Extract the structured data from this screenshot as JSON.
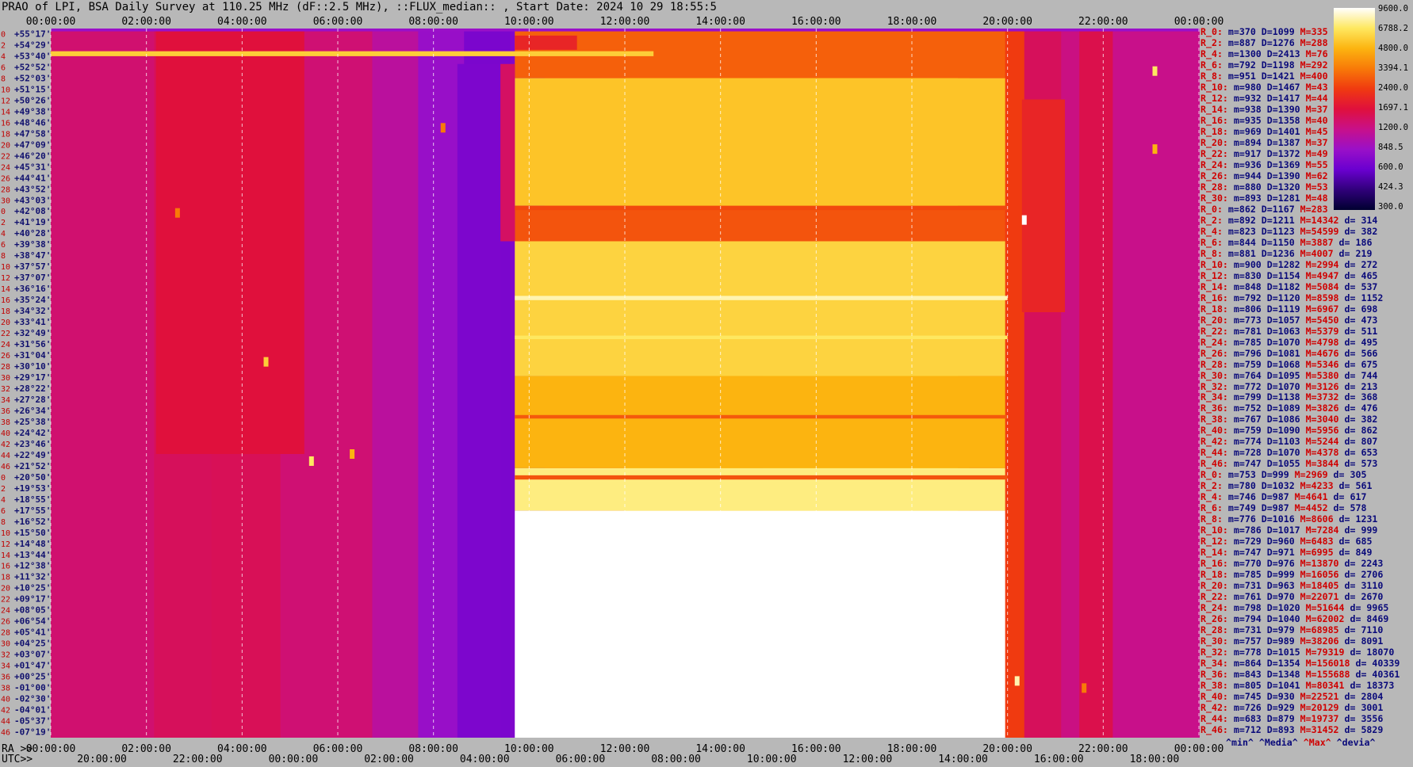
{
  "title": "PRAO of LPI, BSA Daily Survey at 110.25 MHz (dF::2.5 MHz), ::FLUX_median:: , Start Date: 2024 10 29 18:55:5",
  "chart_data": {
    "type": "heatmap",
    "title": "PRAO of LPI, BSA Daily Survey at 110.25 MHz (dF::2.5 MHz), ::FLUX_median:: , Start Date: 2024 10 29 18:55:5",
    "x_top_ticks": [
      "00:00:00",
      "02:00:00",
      "04:00:00",
      "06:00:00",
      "08:00:00",
      "10:00:00",
      "12:00:00",
      "14:00:00",
      "16:00:00",
      "18:00:00",
      "20:00:00",
      "22:00:00",
      "00:00:00"
    ],
    "x_bottom_ra_label": "RA >>",
    "x_bottom_ra_ticks": [
      "00:00:00",
      "02:00:00",
      "04:00:00",
      "06:00:00",
      "08:00:00",
      "10:00:00",
      "12:00:00",
      "14:00:00",
      "16:00:00",
      "18:00:00",
      "20:00:00",
      "22:00:00",
      "00:00:00"
    ],
    "x_bottom_utc_label": "UTC>>",
    "x_bottom_utc_ticks": [
      "20:00:00",
      "22:00:00",
      "00:00:00",
      "02:00:00",
      "04:00:00",
      "06:00:00",
      "08:00:00",
      "10:00:00",
      "12:00:00",
      "14:00:00",
      "16:00:00",
      "18:00:00"
    ],
    "y_rows": [
      {
        "row": "0",
        "dec": "+55°17'"
      },
      {
        "row": "2",
        "dec": "+54°29'"
      },
      {
        "row": "4",
        "dec": "+53°40'"
      },
      {
        "row": "6",
        "dec": "+52°52'"
      },
      {
        "row": "8",
        "dec": "+52°03'"
      },
      {
        "row": "10",
        "dec": "+51°15'"
      },
      {
        "row": "12",
        "dec": "+50°26'"
      },
      {
        "row": "14",
        "dec": "+49°38'"
      },
      {
        "row": "16",
        "dec": "+48°46'"
      },
      {
        "row": "18",
        "dec": "+47°58'"
      },
      {
        "row": "20",
        "dec": "+47°09'"
      },
      {
        "row": "22",
        "dec": "+46°20'"
      },
      {
        "row": "24",
        "dec": "+45°31'"
      },
      {
        "row": "26",
        "dec": "+44°41'"
      },
      {
        "row": "28",
        "dec": "+43°52'"
      },
      {
        "row": "30",
        "dec": "+43°03'"
      },
      {
        "row": "0",
        "dec": "+42°08'"
      },
      {
        "row": "2",
        "dec": "+41°19'"
      },
      {
        "row": "4",
        "dec": "+40°28'"
      },
      {
        "row": "6",
        "dec": "+39°38'"
      },
      {
        "row": "8",
        "dec": "+38°47'"
      },
      {
        "row": "10",
        "dec": "+37°57'"
      },
      {
        "row": "12",
        "dec": "+37°07'"
      },
      {
        "row": "14",
        "dec": "+36°16'"
      },
      {
        "row": "16",
        "dec": "+35°24'"
      },
      {
        "row": "18",
        "dec": "+34°32'"
      },
      {
        "row": "20",
        "dec": "+33°41'"
      },
      {
        "row": "22",
        "dec": "+32°49'"
      },
      {
        "row": "24",
        "dec": "+31°56'"
      },
      {
        "row": "26",
        "dec": "+31°04'"
      },
      {
        "row": "28",
        "dec": "+30°10'"
      },
      {
        "row": "30",
        "dec": "+29°17'"
      },
      {
        "row": "32",
        "dec": "+28°22'"
      },
      {
        "row": "34",
        "dec": "+27°28'"
      },
      {
        "row": "36",
        "dec": "+26°34'"
      },
      {
        "row": "38",
        "dec": "+25°38'"
      },
      {
        "row": "40",
        "dec": "+24°42'"
      },
      {
        "row": "42",
        "dec": "+23°46'"
      },
      {
        "row": "44",
        "dec": "+22°49'"
      },
      {
        "row": "46",
        "dec": "+21°52'"
      },
      {
        "row": "0",
        "dec": "+20°50'"
      },
      {
        "row": "2",
        "dec": "+19°53'"
      },
      {
        "row": "4",
        "dec": "+18°55'"
      },
      {
        "row": "6",
        "dec": "+17°55'"
      },
      {
        "row": "8",
        "dec": "+16°52'"
      },
      {
        "row": "10",
        "dec": "+15°50'"
      },
      {
        "row": "12",
        "dec": "+14°48'"
      },
      {
        "row": "14",
        "dec": "+13°44'"
      },
      {
        "row": "16",
        "dec": "+12°38'"
      },
      {
        "row": "18",
        "dec": "+11°32'"
      },
      {
        "row": "20",
        "dec": "+10°25'"
      },
      {
        "row": "22",
        "dec": "+09°17'"
      },
      {
        "row": "24",
        "dec": "+08°05'"
      },
      {
        "row": "26",
        "dec": "+06°54'"
      },
      {
        "row": "28",
        "dec": "+05°41'"
      },
      {
        "row": "30",
        "dec": "+04°25'"
      },
      {
        "row": "32",
        "dec": "+03°07'"
      },
      {
        "row": "34",
        "dec": "+01°47'"
      },
      {
        "row": "36",
        "dec": "+00°25'"
      },
      {
        "row": "38",
        "dec": "-01°00'"
      },
      {
        "row": "40",
        "dec": "-02°30'"
      },
      {
        "row": "42",
        "dec": "-04°01'"
      },
      {
        "row": "44",
        "dec": "-05°37'"
      },
      {
        "row": "46",
        "dec": "-07°19'"
      }
    ],
    "colorbar_ticks": [
      "9600.0",
      "6788.2",
      "4800.0",
      "3394.1",
      "2400.0",
      "1697.1",
      "1200.0",
      "848.5",
      "600.0",
      "424.3",
      "300.0"
    ],
    "colorbar_range": [
      300,
      9600
    ],
    "colorbar_scale": "log",
    "colormap_stops": [
      "#000030",
      "#30007a",
      "#6a00d0",
      "#9a10c8",
      "#c8108a",
      "#e0103c",
      "#f03a10",
      "#f87a08",
      "#fcb410",
      "#fee860",
      "#ffffff"
    ],
    "stats": [
      {
        "ch": "R_0:",
        "m": "370",
        "d": "1099",
        "max": "335",
        "dev": ""
      },
      {
        "ch": "R_2:",
        "m": "887",
        "d": "1276",
        "max": "288",
        "dev": ""
      },
      {
        "ch": "R_4:",
        "m": "1300",
        "d": "2413",
        "max": "76",
        "dev": ""
      },
      {
        "ch": "R_6:",
        "m": "792",
        "d": "1198",
        "max": "292",
        "dev": ""
      },
      {
        "ch": "R_8:",
        "m": "951",
        "d": "1421",
        "max": "400",
        "dev": ""
      },
      {
        "ch": "R_10:",
        "m": "980",
        "d": "1467",
        "max": "43",
        "dev": ""
      },
      {
        "ch": "R_12:",
        "m": "932",
        "d": "1417",
        "max": "44",
        "dev": ""
      },
      {
        "ch": "R_14:",
        "m": "938",
        "d": "1390",
        "max": "37",
        "dev": ""
      },
      {
        "ch": "R_16:",
        "m": "935",
        "d": "1358",
        "max": "40",
        "dev": ""
      },
      {
        "ch": "R_18:",
        "m": "969",
        "d": "1401",
        "max": "45",
        "dev": ""
      },
      {
        "ch": "R_20:",
        "m": "894",
        "d": "1387",
        "max": "37",
        "dev": ""
      },
      {
        "ch": "R_22:",
        "m": "917",
        "d": "1372",
        "max": "49",
        "dev": ""
      },
      {
        "ch": "R_24:",
        "m": "936",
        "d": "1369",
        "max": "55",
        "dev": ""
      },
      {
        "ch": "R_26:",
        "m": "944",
        "d": "1390",
        "max": "62",
        "dev": ""
      },
      {
        "ch": "R_28:",
        "m": "880",
        "d": "1320",
        "max": "53",
        "dev": ""
      },
      {
        "ch": "R_30:",
        "m": "893",
        "d": "1281",
        "max": "48",
        "dev": ""
      },
      {
        "ch": "R_0:",
        "m": "862",
        "d": "1167",
        "max": "283",
        "dev": ""
      },
      {
        "ch": "R_2:",
        "m": "892",
        "d": "1211",
        "max": "14342",
        "dev": "314"
      },
      {
        "ch": "R_4:",
        "m": "823",
        "d": "1123",
        "max": "54599",
        "dev": "382"
      },
      {
        "ch": "R_6:",
        "m": "844",
        "d": "1150",
        "max": "3887",
        "dev": "186"
      },
      {
        "ch": "R_8:",
        "m": "881",
        "d": "1236",
        "max": "4007",
        "dev": "219"
      },
      {
        "ch": "R_10:",
        "m": "900",
        "d": "1282",
        "max": "2994",
        "dev": "272"
      },
      {
        "ch": "R_12:",
        "m": "830",
        "d": "1154",
        "max": "4947",
        "dev": "465"
      },
      {
        "ch": "R_14:",
        "m": "848",
        "d": "1182",
        "max": "5084",
        "dev": "537"
      },
      {
        "ch": "R_16:",
        "m": "792",
        "d": "1120",
        "max": "8598",
        "dev": "1152"
      },
      {
        "ch": "R_18:",
        "m": "806",
        "d": "1119",
        "max": "6967",
        "dev": "698"
      },
      {
        "ch": "R_20:",
        "m": "773",
        "d": "1057",
        "max": "5450",
        "dev": "473"
      },
      {
        "ch": "R_22:",
        "m": "781",
        "d": "1063",
        "max": "5379",
        "dev": "511"
      },
      {
        "ch": "R_24:",
        "m": "785",
        "d": "1070",
        "max": "4798",
        "dev": "495"
      },
      {
        "ch": "R_26:",
        "m": "796",
        "d": "1081",
        "max": "4676",
        "dev": "566"
      },
      {
        "ch": "R_28:",
        "m": "759",
        "d": "1068",
        "max": "5346",
        "dev": "675"
      },
      {
        "ch": "R_30:",
        "m": "764",
        "d": "1095",
        "max": "5380",
        "dev": "744"
      },
      {
        "ch": "R_32:",
        "m": "772",
        "d": "1070",
        "max": "3126",
        "dev": "213"
      },
      {
        "ch": "R_34:",
        "m": "799",
        "d": "1138",
        "max": "3732",
        "dev": "368"
      },
      {
        "ch": "R_36:",
        "m": "752",
        "d": "1089",
        "max": "3826",
        "dev": "476"
      },
      {
        "ch": "R_38:",
        "m": "767",
        "d": "1086",
        "max": "3040",
        "dev": "382"
      },
      {
        "ch": "R_40:",
        "m": "759",
        "d": "1090",
        "max": "5956",
        "dev": "862"
      },
      {
        "ch": "R_42:",
        "m": "774",
        "d": "1103",
        "max": "5244",
        "dev": "807"
      },
      {
        "ch": "R_44:",
        "m": "728",
        "d": "1070",
        "max": "4378",
        "dev": "653"
      },
      {
        "ch": "R_46:",
        "m": "747",
        "d": "1055",
        "max": "3844",
        "dev": "573"
      },
      {
        "ch": "R_0:",
        "m": "753",
        "d": "999",
        "max": "2969",
        "dev": "305"
      },
      {
        "ch": "R_2:",
        "m": "780",
        "d": "1032",
        "max": "4233",
        "dev": "561"
      },
      {
        "ch": "R_4:",
        "m": "746",
        "d": "987",
        "max": "4641",
        "dev": "617"
      },
      {
        "ch": "R_6:",
        "m": "749",
        "d": "987",
        "max": "4452",
        "dev": "578"
      },
      {
        "ch": "R_8:",
        "m": "776",
        "d": "1016",
        "max": "8606",
        "dev": "1231"
      },
      {
        "ch": "R_10:",
        "m": "786",
        "d": "1017",
        "max": "7284",
        "dev": "999"
      },
      {
        "ch": "R_12:",
        "m": "729",
        "d": "960",
        "max": "6483",
        "dev": "685"
      },
      {
        "ch": "R_14:",
        "m": "747",
        "d": "971",
        "max": "6995",
        "dev": "849"
      },
      {
        "ch": "R_16:",
        "m": "770",
        "d": "976",
        "max": "13870",
        "dev": "2243"
      },
      {
        "ch": "R_18:",
        "m": "785",
        "d": "999",
        "max": "16056",
        "dev": "2706"
      },
      {
        "ch": "R_20:",
        "m": "731",
        "d": "963",
        "max": "18405",
        "dev": "3110"
      },
      {
        "ch": "R_22:",
        "m": "761",
        "d": "970",
        "max": "22071",
        "dev": "2670"
      },
      {
        "ch": "R_24:",
        "m": "798",
        "d": "1020",
        "max": "51644",
        "dev": "9965"
      },
      {
        "ch": "R_26:",
        "m": "794",
        "d": "1040",
        "max": "62002",
        "dev": "8469"
      },
      {
        "ch": "R_28:",
        "m": "731",
        "d": "979",
        "max": "68985",
        "dev": "7110"
      },
      {
        "ch": "R_30:",
        "m": "757",
        "d": "989",
        "max": "38206",
        "dev": "8091"
      },
      {
        "ch": "R_32:",
        "m": "778",
        "d": "1015",
        "max": "79319",
        "dev": "18070"
      },
      {
        "ch": "R_34:",
        "m": "864",
        "d": "1354",
        "max": "156018",
        "dev": "40339"
      },
      {
        "ch": "R_36:",
        "m": "843",
        "d": "1348",
        "max": "155688",
        "dev": "40361"
      },
      {
        "ch": "R_38:",
        "m": "805",
        "d": "1041",
        "max": "80341",
        "dev": "18373"
      },
      {
        "ch": "R_40:",
        "m": "745",
        "d": "930",
        "max": "22521",
        "dev": "2804"
      },
      {
        "ch": "R_42:",
        "m": "726",
        "d": "929",
        "max": "20129",
        "dev": "3001"
      },
      {
        "ch": "R_44:",
        "m": "683",
        "d": "879",
        "max": "19737",
        "dev": "3556"
      },
      {
        "ch": "R_46:",
        "m": "712",
        "d": "893",
        "max": "31452",
        "dev": "5829"
      }
    ],
    "stats_footer": {
      "min": "^min^",
      "median": "^Media^",
      "max": "^Max^",
      "dev": "^devia^"
    }
  }
}
